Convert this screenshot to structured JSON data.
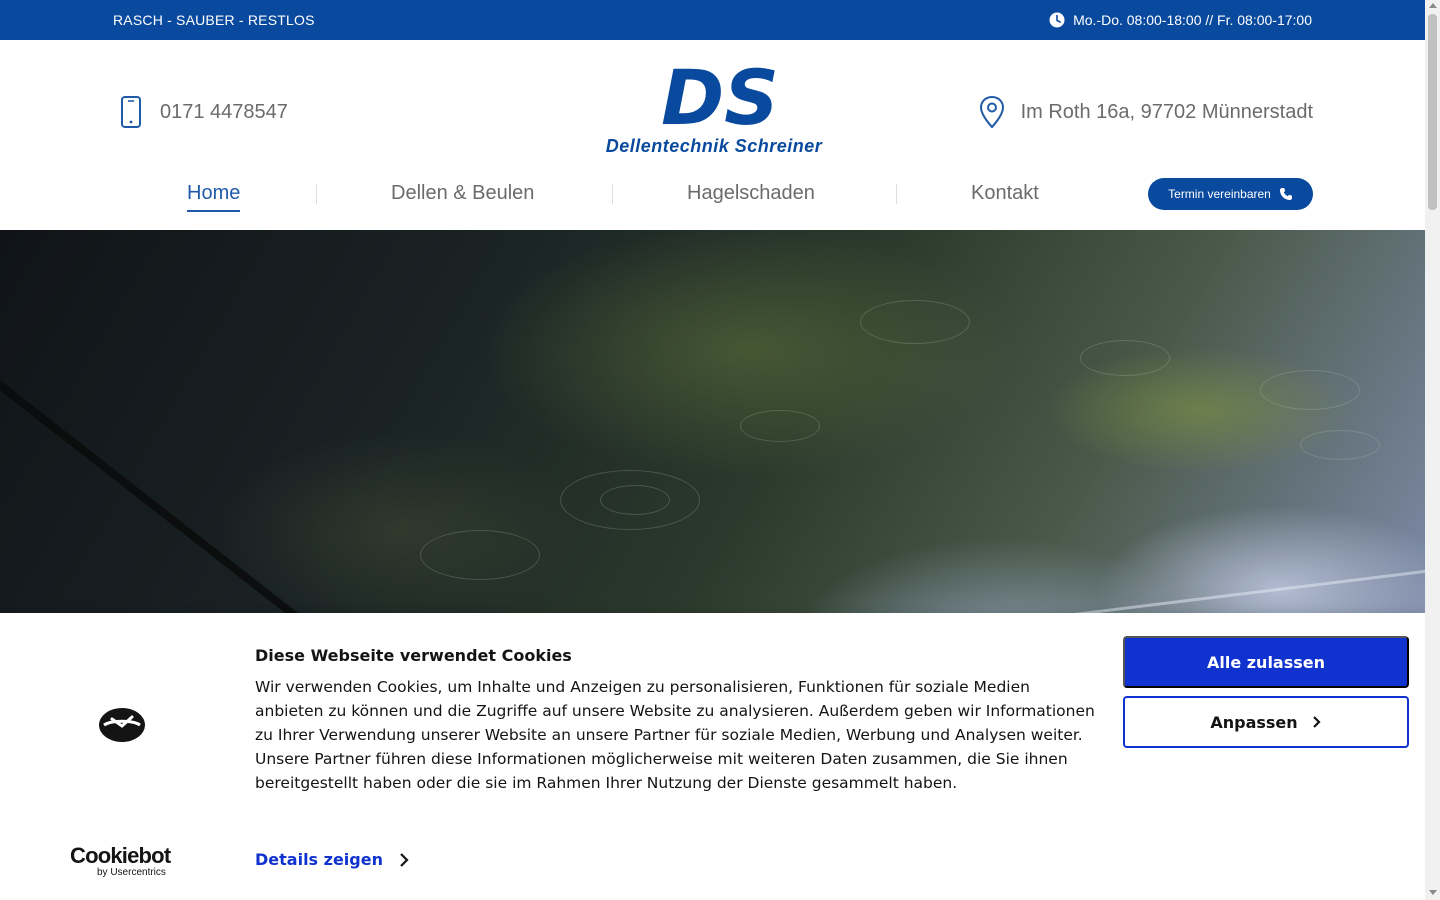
{
  "topbar": {
    "slogan": "RASCH - SAUBER - RESTLOS",
    "hours": "Mo.-Do. 08:00-18:00 // Fr. 08:00-17:00",
    "bg_color": "#0a4a9e"
  },
  "header": {
    "phone": "0171 4478547",
    "address": "Im Roth 16a, 97702 Münnerstadt",
    "logo_initials": "DS",
    "logo_name": "Dellentechnik Schreiner"
  },
  "nav": {
    "items": [
      {
        "label": "Home",
        "active": true
      },
      {
        "label": "Dellen & Beulen"
      },
      {
        "label": "Hagelschaden"
      },
      {
        "label": "Kontakt"
      }
    ],
    "cta_label": "Termin vereinbaren"
  },
  "cookie": {
    "title": "Diese Webseite verwendet Cookies",
    "text": "Wir verwenden Cookies, um Inhalte und Anzeigen zu personalisieren, Funktionen für soziale Medien anbieten zu können und die Zugriffe auf unsere Website zu analysieren. Außerdem geben wir Informationen zu Ihrer Verwendung unserer Website an unsere Partner für soziale Medien, Werbung und Analysen weiter. Unsere Partner führen diese Informationen möglicherweise mit weiteren Daten zusammen, die Sie ihnen bereitgestellt haben oder die sie im Rahmen Ihrer Nutzung der Dienste gesammelt haben.",
    "details_label": "Details zeigen",
    "allow_label": "Alle zulassen",
    "adjust_label": "Anpassen",
    "brand_name": "Cookiebot",
    "brand_sub": "by Usercentrics",
    "accent_color": "#1032cf"
  }
}
